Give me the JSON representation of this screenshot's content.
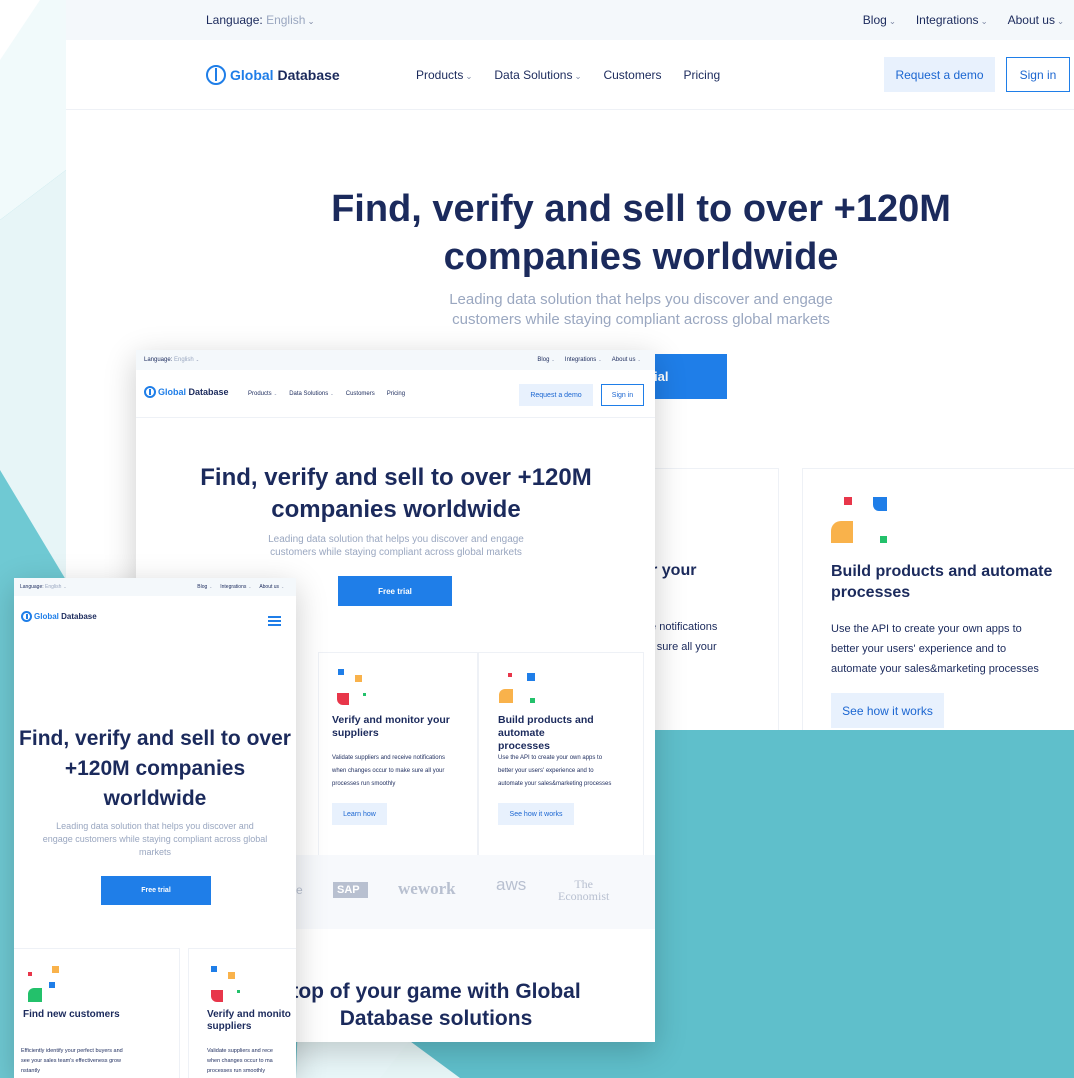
{
  "colors": {
    "accent": "#1f7ee8",
    "navy": "#1b2a5c",
    "muted": "#9aa7c0",
    "background": "#6fc9d3"
  },
  "top": {
    "language_label": "Language:",
    "language_value": "English",
    "blog": "Blog",
    "integrations": "Integrations",
    "about": "About us"
  },
  "brand": {
    "global": "Global",
    "database": "Database"
  },
  "nav": {
    "products": "Products",
    "data_solutions": "Data Solutions",
    "customers": "Customers",
    "pricing": "Pricing",
    "request_demo": "Request a demo",
    "sign_in": "Sign in"
  },
  "hero": {
    "title_line1": "Find, verify and sell to over +120M",
    "title_line2": "companies worldwide",
    "subtitle_line1": "Leading data solution that helps you discover and engage",
    "subtitle_line2": "customers while staying compliant across global markets",
    "cta": "Free trial",
    "cta_partial": "ial"
  },
  "mobile_hero": {
    "title_line1": "Find, verify and sell to over",
    "title_line2": "+120M companies",
    "title_line3": "worldwide",
    "subtitle_line1": "Leading data solution that helps you discover and",
    "subtitle_line2": "engage customers while staying compliant across global",
    "subtitle_line3": "markets"
  },
  "cards": {
    "find": {
      "title": "Find new customers",
      "line1": "Efficiently identify your perfect buyers and",
      "line2": "see your sales team's effectiveness grow",
      "line3": "instantly"
    },
    "verify": {
      "title_line1": "Verify and monitor your",
      "title_line2": "suppliers",
      "line1": "Validate suppliers and receive notifications",
      "line2": "when changes occur to make sure all your",
      "line3": "processes run smoothly",
      "cta": "Learn how"
    },
    "build": {
      "title_line1": "Build products and automate",
      "title_line2": "processes",
      "line1": "Use the API to create your own apps to",
      "line2": "better your users' experience and to",
      "line3": "automate your sales&marketing processes",
      "cta": "See how it works"
    }
  },
  "partial": {
    "verify_title": "tor your",
    "verify_line1": "eive notifications",
    "verify_line2": "ake sure all your",
    "mobile_verify_title1": "Verify and monito",
    "mobile_verify_title2": "suppliers",
    "mobile_verify_line1": "Validate suppliers and rece",
    "mobile_verify_line2": "when changes occur to ma",
    "mobile_verify_line3": "processes run smoothly",
    "mobile_find_line1": "Efficiently identify your perfect buyers and",
    "mobile_find_line2": "see your sales team's effectiveness grow",
    "mobile_find_line3": "nstantly",
    "logo_e": "e"
  },
  "logos": {
    "sap": "SAP",
    "wework": "wework",
    "aws": "aws",
    "economist1": "The",
    "economist2": "Economist"
  },
  "bottom": {
    "line1": "top of your game with Global",
    "line2": "Database solutions"
  },
  "icons": [
    "caret-down-icon",
    "global-database-logo-icon",
    "hamburger-menu-icon",
    "card-shapes-icon"
  ]
}
